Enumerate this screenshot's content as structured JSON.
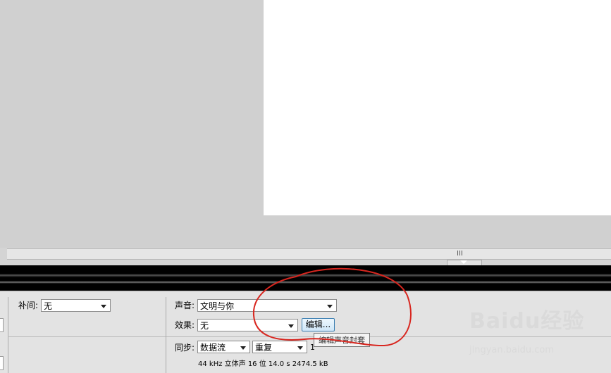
{
  "panel": {
    "tween_label": "补间:",
    "tween_value": "无",
    "sound_label": "声音:",
    "sound_value": "文明与你",
    "effect_label": "效果:",
    "effect_value": "无",
    "edit_button": "编辑...",
    "tooltip": "编辑声音封套",
    "sync_label": "同步:",
    "sync_value": "数据流",
    "repeat_value": "重复",
    "repeat_count": "1",
    "sound_info": "44 kHz 立体声 16 位 14.0 s 2474.5 kB"
  },
  "scrollbar": {
    "grip": "III"
  },
  "watermark": {
    "logo": "Baidu经验",
    "url": "jingyan.baidu.com"
  },
  "colors": {
    "annotation": "#d8261f",
    "stage": "#d0d0d0",
    "canvas": "#ffffff"
  }
}
